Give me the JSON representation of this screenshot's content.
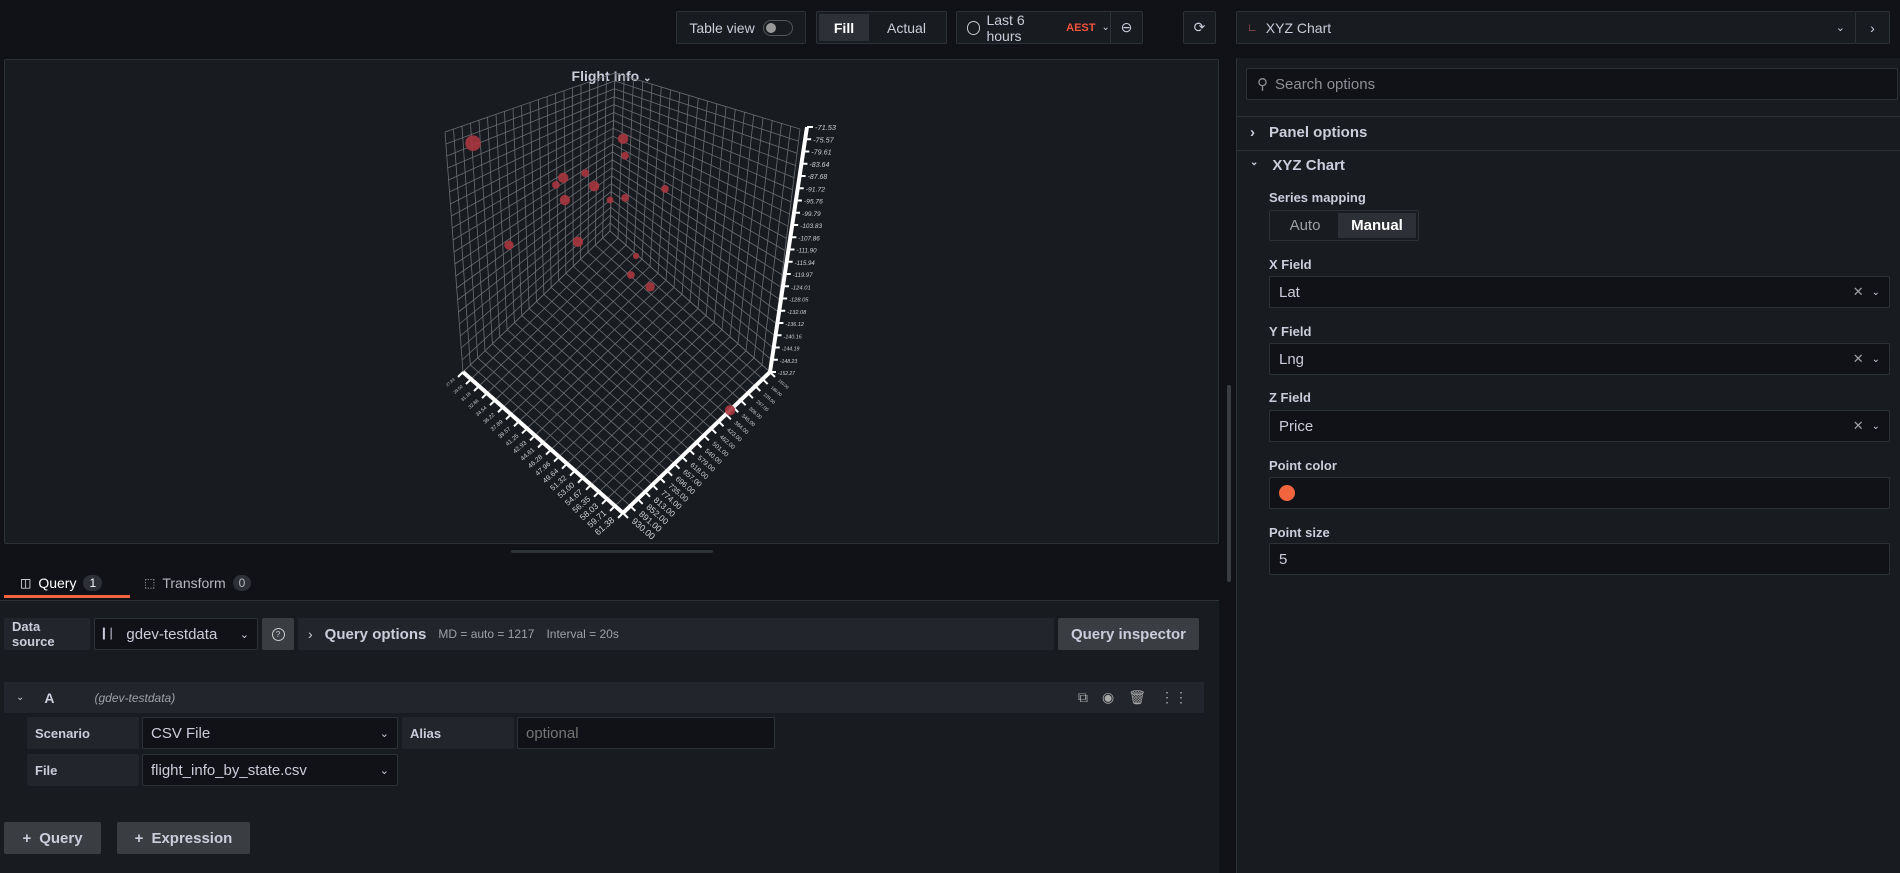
{
  "toolbar": {
    "table_view": "Table view",
    "fill": "Fill",
    "actual": "Actual",
    "time_range": "Last 6 hours",
    "timezone": "AEST",
    "visualization": "XYZ Chart"
  },
  "panel": {
    "title": "Flight Info"
  },
  "tabs": [
    {
      "label": "Query",
      "count": "1"
    },
    {
      "label": "Transform",
      "count": "0"
    }
  ],
  "query_bar": {
    "data_source_label": "Data source",
    "data_source": "gdev-testdata",
    "query_options": "Query options",
    "md": "MD = auto = 1217",
    "interval": "Interval = 20s",
    "inspector": "Query inspector"
  },
  "query_a": {
    "ref": "A",
    "source": "(gdev-testdata)",
    "scenario_label": "Scenario",
    "scenario": "CSV File",
    "alias_label": "Alias",
    "alias_placeholder": "optional",
    "file_label": "File",
    "file": "flight_info_by_state.csv"
  },
  "buttons": {
    "add_query": "Query",
    "add_expression": "Expression"
  },
  "options": {
    "search_placeholder": "Search options",
    "panel_options": "Panel options",
    "xyz_section": "XYZ Chart",
    "series_mapping_label": "Series mapping",
    "series_mapping": [
      "Auto",
      "Manual"
    ],
    "series_mapping_selected": "Manual",
    "x_field_label": "X Field",
    "x_field": "Lat",
    "y_field_label": "Y Field",
    "y_field": "Lng",
    "z_field_label": "Z Field",
    "z_field": "Price",
    "point_color_label": "Point color",
    "point_color": "#f2643d",
    "point_size_label": "Point size",
    "point_size": "5"
  },
  "chart_data": {
    "type": "scatter3d",
    "title": "Flight Info",
    "x_axis": {
      "field": "Lat",
      "ticks": [
        "61.38",
        "59.71",
        "58.03",
        "56.35",
        "54.67",
        "53.00",
        "51.32",
        "49.64",
        "47.96",
        "46.28",
        "44.61",
        "42.93",
        "41.25",
        "39.57",
        "37.89",
        "36.22",
        "34.54",
        "32.86",
        "31.18",
        "29.50",
        "27.83"
      ],
      "range": [
        61.38,
        27.83
      ]
    },
    "y_axis": {
      "field": "Lng",
      "ticks": [
        "-152.27",
        "-148.23",
        "-144.19",
        "-140.16",
        "-136.12",
        "-132.08",
        "-128.05",
        "-124.01",
        "-119.97",
        "-115.94",
        "-111.90",
        "-107.86",
        "-103.83",
        "-99.79",
        "-95.76",
        "-91.72",
        "-87.68",
        "-83.64",
        "-79.61",
        "-75.57",
        "-71.53"
      ],
      "range": [
        -152.27,
        -71.53
      ]
    },
    "z_axis": {
      "field": "Price",
      "ticks": [
        "930.00",
        "891.00",
        "852.00",
        "813.00",
        "774.00",
        "735.00",
        "696.00",
        "657.00",
        "618.00",
        "579.00",
        "540.00",
        "501.00",
        "462.00",
        "423.00",
        "384.00",
        "345.00",
        "306.00",
        "267.00",
        "228.00",
        "189.00",
        "150.00"
      ],
      "range": [
        930,
        150
      ]
    },
    "point_fill": "#a8363f",
    "points": [
      {
        "lat": 27.83,
        "lng": -77.7,
        "price": 916,
        "size": 3
      },
      {
        "lat": 38.26,
        "lng": -94.05,
        "price": 375,
        "size": 2
      },
      {
        "lat": 38.53,
        "lng": -99.6,
        "price": 369,
        "size": 1.5
      },
      {
        "lat": 34.24,
        "lng": -105.3,
        "price": 469,
        "size": 1.5
      },
      {
        "lat": 31.86,
        "lng": -106.9,
        "price": 524,
        "size": 2
      },
      {
        "lat": 31.09,
        "lng": -109.2,
        "price": 542,
        "size": 1.5
      },
      {
        "lat": 35.28,
        "lng": -109.6,
        "price": 445,
        "size": 2
      },
      {
        "lat": 32.12,
        "lng": -114.2,
        "price": 518,
        "size": 2
      },
      {
        "lat": 37.05,
        "lng": -114.2,
        "price": 403,
        "size": 1.3
      },
      {
        "lat": 38.7,
        "lng": -113.5,
        "price": 365,
        "size": 1.5
      },
      {
        "lat": 43.03,
        "lng": -110.5,
        "price": 265,
        "size": 1.5
      },
      {
        "lat": 27.83,
        "lng": -124.1,
        "price": 701,
        "size": 1.8
      },
      {
        "lat": 33.7,
        "lng": -128.0,
        "price": 481,
        "size": 2
      },
      {
        "lat": 40.11,
        "lng": -132.6,
        "price": 333,
        "size": 1.2
      },
      {
        "lat": 39.61,
        "lng": -138.9,
        "price": 344,
        "size": 1.5
      },
      {
        "lat": 41.75,
        "lng": -142.8,
        "price": 294,
        "size": 1.8
      },
      {
        "lat": 61.38,
        "lng": -152.27,
        "price": 362,
        "size": 2
      }
    ]
  }
}
